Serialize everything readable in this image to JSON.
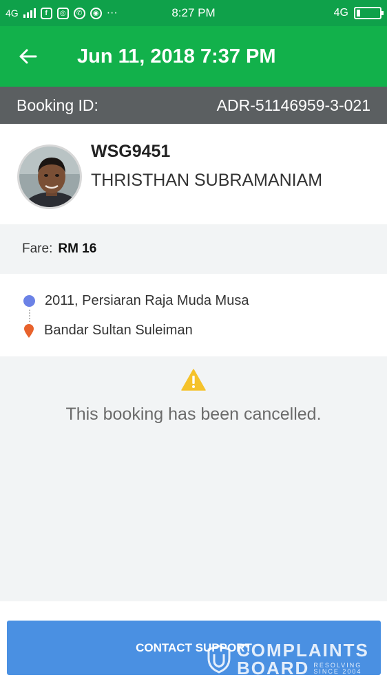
{
  "status_bar": {
    "network_left": "4G",
    "notification_icons": [
      "facebook-icon",
      "instagram-icon",
      "whatsapp-icon",
      "chrome-icon",
      "more-icon"
    ],
    "more": "···",
    "time": "8:27 PM",
    "network_right": "4G",
    "battery_level": 0.15
  },
  "app_bar": {
    "title": "Jun 11, 2018 7:37 PM",
    "back_icon": "arrow-left-icon"
  },
  "booking": {
    "label": "Booking ID:",
    "id": "ADR-51146959-3-021"
  },
  "driver": {
    "plate": "WSG9451",
    "name": "THRISTHAN SUBRAMANIAM"
  },
  "fare": {
    "label": "Fare:",
    "value": "RM 16"
  },
  "route": {
    "pickup": "2011, Persiaran Raja Muda Musa",
    "dropoff": "Bandar Sultan Suleiman"
  },
  "status": {
    "message": "This booking has been cancelled."
  },
  "actions": {
    "contact_support": "CONTACT SUPPORT"
  },
  "watermark": {
    "line1": "COMPLAINTS",
    "line2": "BOARD",
    "small1": "RESOLVING",
    "small2": "SINCE 2004"
  },
  "colors": {
    "status_bar": "#0fa14a",
    "app_bar": "#12b14b",
    "booking_bar": "#5b5f61",
    "button": "#4a90e2",
    "pickup_dot": "#6b82e6",
    "dropoff_pin": "#e8622c",
    "warning": "#f5c22b"
  }
}
